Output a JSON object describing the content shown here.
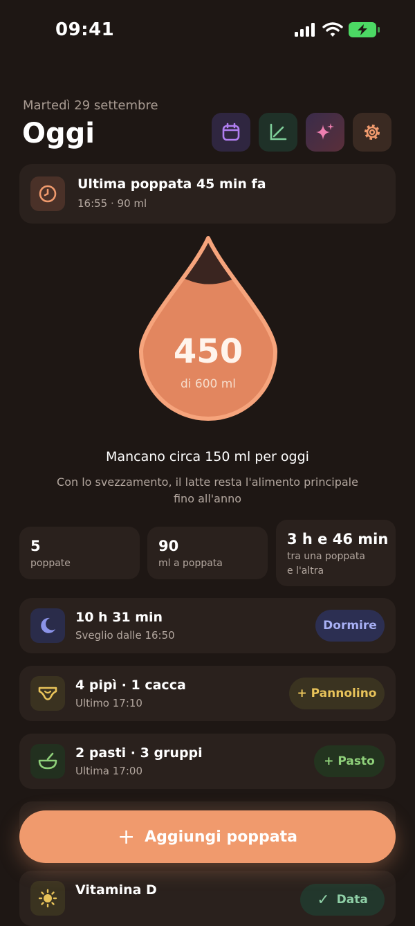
{
  "status_bar": {
    "time": "09:41"
  },
  "header": {
    "date": "Martedì 29 settembre",
    "title": "Oggi"
  },
  "header_buttons": [
    {
      "icon": "calendar-icon",
      "bg": "#2f2640",
      "color": "#b07ef0"
    },
    {
      "icon": "chart-icon",
      "bg": "#1f3128",
      "color": "#7fcf9b"
    },
    {
      "icon": "sparkle-icon",
      "bg": "#4a2f3a",
      "color": "#ef7fb0"
    },
    {
      "icon": "gear-icon",
      "bg": "#3a2a22",
      "color": "#f09a6d"
    }
  ],
  "last_feed": {
    "title": "Ultima poppata 45 min fa",
    "subtitle": "16:55 · 90 ml"
  },
  "drop": {
    "amount": "450",
    "of_label": "di 600 ml",
    "fill_fraction": 0.75
  },
  "message": {
    "title": "Mancano circa 150 ml per oggi",
    "line1": "Con lo svezzamento, il latte resta l'alimento principale",
    "line2": "fino all'anno"
  },
  "stats": [
    {
      "value": "5",
      "label": "poppate"
    },
    {
      "value": "90",
      "label": "ml a poppata"
    },
    {
      "value": "3 h e 46 min",
      "label_line1": "tra una poppata",
      "label_line2": "e l'altra"
    }
  ],
  "sleep": {
    "title": "10 h 31 min",
    "subtitle": "Sveglio dalle 16:50",
    "button": "Dormire"
  },
  "diaper": {
    "title": "4 pipì · 1 cacca",
    "subtitle": "Ultimo 17:10",
    "button": "+ Pannolino"
  },
  "meals": {
    "title": "2 pasti · 3 gruppi",
    "subtitle": "Ultima 17:00",
    "button": "+ Pasto"
  },
  "add_feed_button": {
    "plus": "+",
    "label": "Aggiungi poppata"
  },
  "vitamin": {
    "title": "Vitamina D",
    "button": "Data"
  },
  "colors": {
    "accent": "#f09a6d",
    "background": "#1e1714",
    "card": "#2a211d"
  }
}
